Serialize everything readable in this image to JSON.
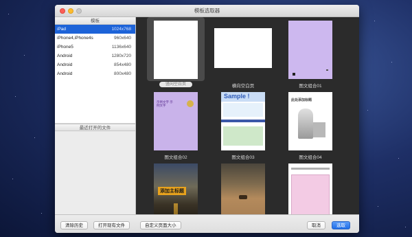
{
  "window": {
    "title": "模板选取器"
  },
  "sidebar": {
    "header": "模板",
    "templates": [
      {
        "name": "iPad",
        "size": "1024x768",
        "selected": true
      },
      {
        "name": "iPhone4,iPhone4s",
        "size": "960x640",
        "selected": false
      },
      {
        "name": "iPhone5",
        "size": "1136x640",
        "selected": false
      },
      {
        "name": "Android",
        "size": "1280x720",
        "selected": false
      },
      {
        "name": "Android",
        "size": "854x480",
        "selected": false
      },
      {
        "name": "Android",
        "size": "800x480",
        "selected": false
      }
    ],
    "recent_header": "最近打开的文件"
  },
  "grid": {
    "tiles": [
      {
        "caption": "竖向空白页",
        "selected": true,
        "style": "blank-portrait"
      },
      {
        "caption": "横向空白页",
        "selected": false,
        "style": "blank-landscape"
      },
      {
        "caption": "图文组合01",
        "selected": false,
        "style": "purple"
      },
      {
        "caption": "图文组合02",
        "selected": false,
        "style": "purple-text",
        "thumb_text": "示例文字 示例文字"
      },
      {
        "caption": "图文组合03",
        "selected": false,
        "style": "sample",
        "thumb_text": "Sample !"
      },
      {
        "caption": "图文组合04",
        "selected": false,
        "style": "figure",
        "thumb_text": "此处添加标题"
      },
      {
        "caption": "",
        "selected": false,
        "style": "road",
        "thumb_text": "添加主标题"
      },
      {
        "caption": "",
        "selected": false,
        "style": "desert"
      },
      {
        "caption": "",
        "selected": false,
        "style": "pink-form"
      }
    ]
  },
  "buttons": {
    "clear_history": "清除历史",
    "open_existing": "打开现有文件",
    "custom_size": "自定义页面大小",
    "cancel": "取消",
    "choose": "选取"
  },
  "colors": {
    "accent": "#1d63d8",
    "grid_bg": "#2b2b2b",
    "purple": "#cdb8ef"
  }
}
